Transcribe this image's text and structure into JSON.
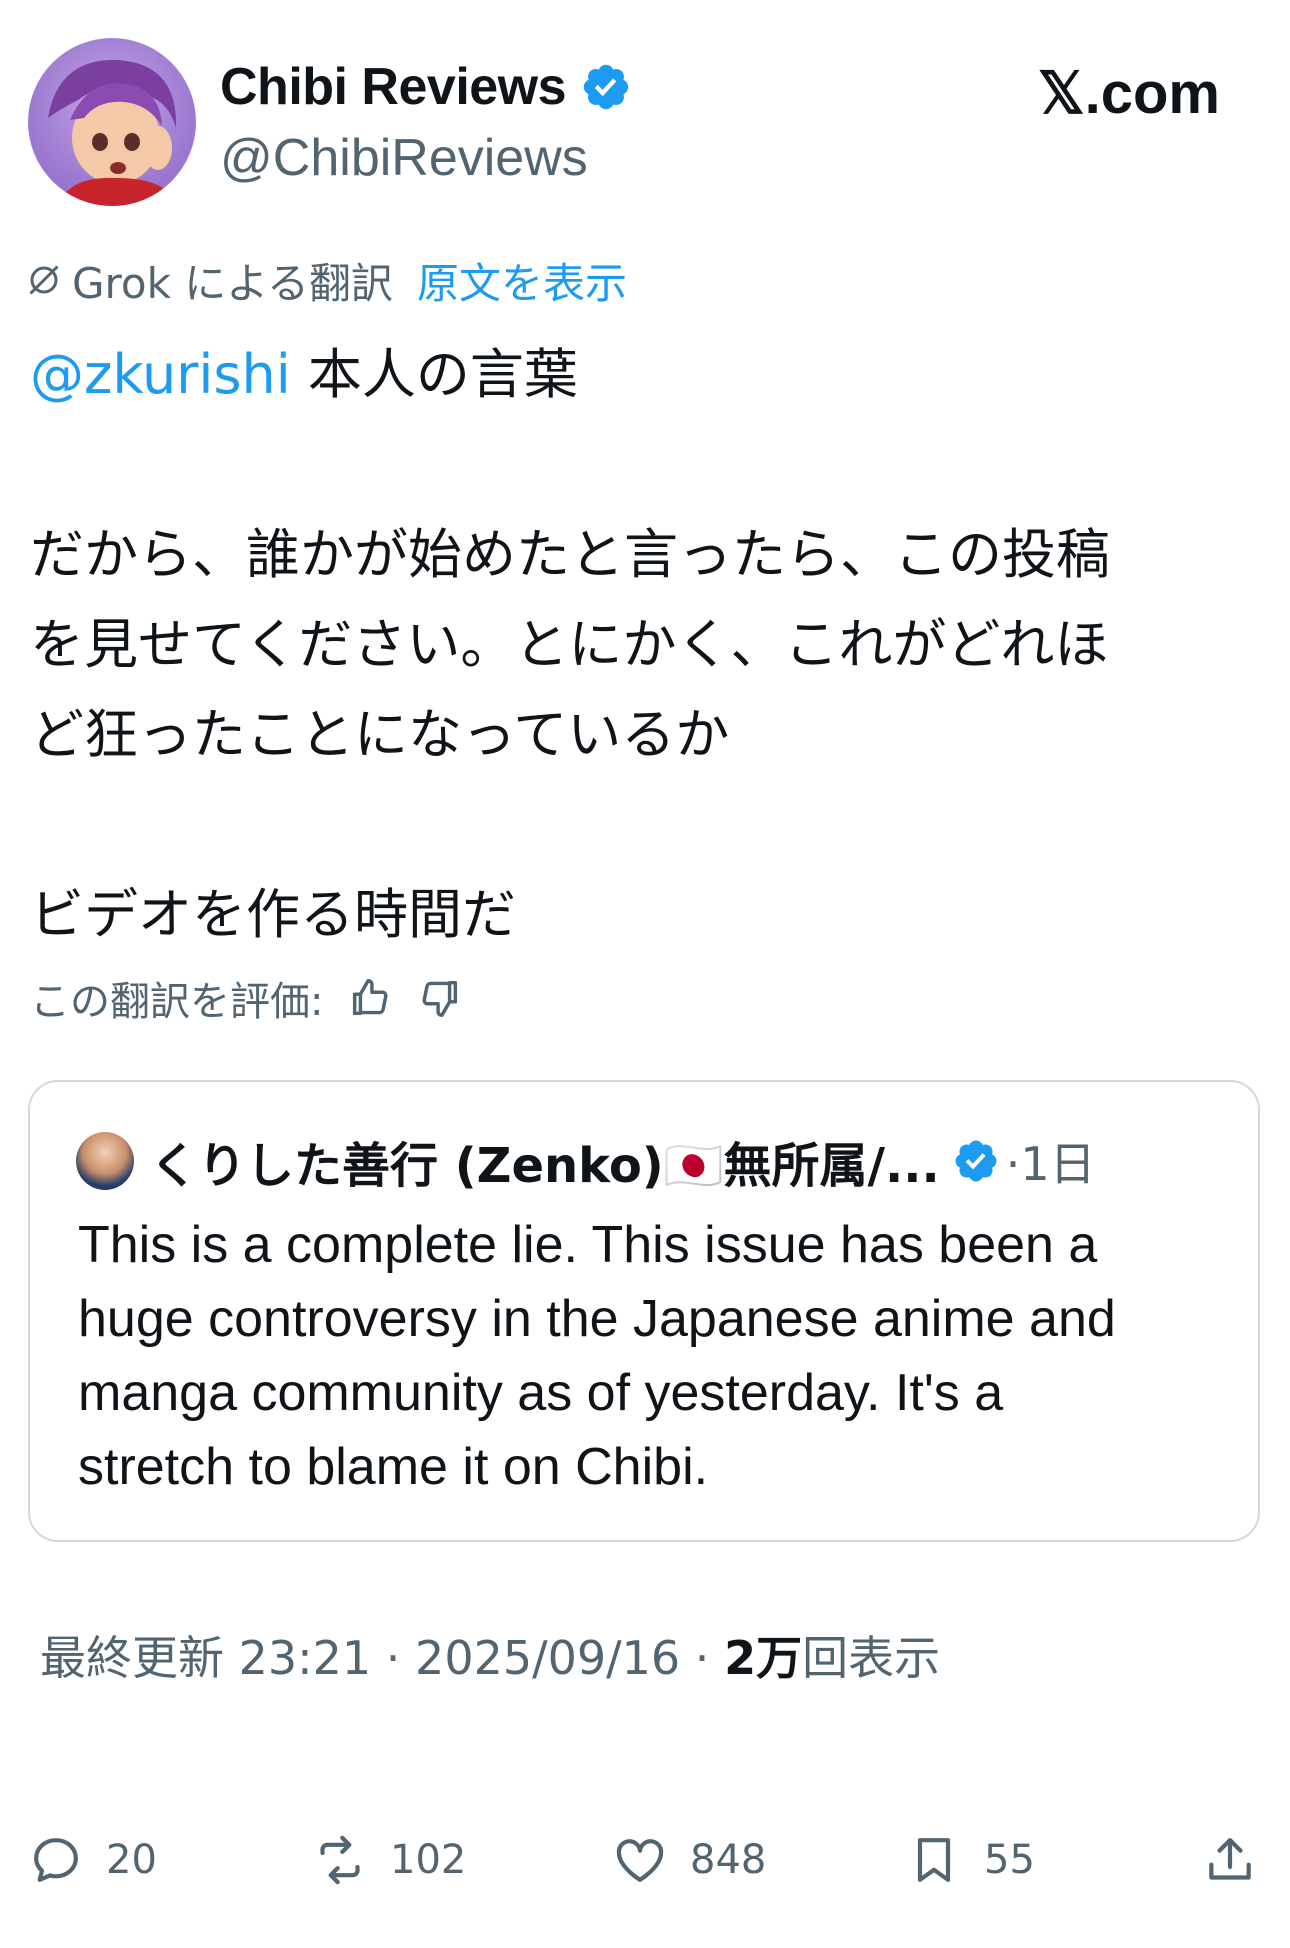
{
  "author": {
    "display_name": "Chibi Reviews",
    "handle": "@ChibiReviews",
    "verified": true,
    "avatar_icon": "anime-avatar"
  },
  "site_label": "𝕏.com",
  "translation": {
    "label": "Grok による翻訳",
    "show_original": "原文を表示",
    "rate_label": "この翻訳を評価:"
  },
  "tweet": {
    "mention": "@zkurishi",
    "line1_rest": "本人の言葉",
    "paragraph2_lines": [
      "だから、誰かが始めたと言ったら、この投稿",
      "を見せてください。とにかく、これがどれほ",
      "ど狂ったことになっているか"
    ],
    "paragraph3": "ビデオを作る時間だ"
  },
  "quote": {
    "name": "くりした善行 (Zenko)🇯🇵無所属/...",
    "verified": true,
    "time": "·1日",
    "text_lines": [
      "This is a complete lie. This issue has been a",
      "huge controversy in the Japanese anime and",
      "manga community as of yesterday. It's a",
      "stretch to blame it on Chibi."
    ]
  },
  "meta": {
    "prefix": "最終更新 23:21 · 2025/09/16 · ",
    "views_count": "2万",
    "views_label": "回表示"
  },
  "actions": {
    "replies": "20",
    "reposts": "102",
    "likes": "848",
    "bookmarks": "55"
  },
  "colors": {
    "accent": "#1d9bf0",
    "text": "#0f1419",
    "secondary": "#536471",
    "border": "#cfd9de"
  }
}
